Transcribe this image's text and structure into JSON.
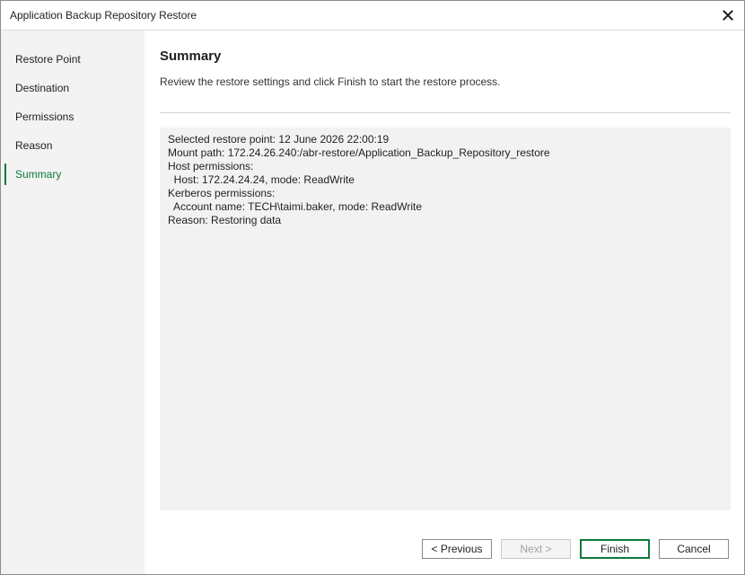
{
  "window": {
    "title": "Application Backup Repository Restore"
  },
  "sidebar": {
    "items": [
      {
        "label": "Restore Point"
      },
      {
        "label": "Destination"
      },
      {
        "label": "Permissions"
      },
      {
        "label": "Reason"
      },
      {
        "label": "Summary",
        "active": true
      }
    ]
  },
  "main": {
    "title": "Summary",
    "description": "Review the restore settings and click Finish to start the restore process.",
    "summary_lines": [
      "Selected restore point: 12 June 2026 22:00:19",
      "Mount path: 172.24.26.240:/abr-restore/Application_Backup_Repository_restore",
      "Host permissions:",
      "  Host: 172.24.24.24, mode: ReadWrite",
      "Kerberos permissions:",
      "  Account name: TECH\\taimi.baker, mode: ReadWrite",
      "Reason: Restoring data"
    ]
  },
  "buttons": {
    "previous": "< Previous",
    "next": "Next >",
    "finish": "Finish",
    "cancel": "Cancel"
  },
  "colors": {
    "accent": "#0f7a3a",
    "sidebar_bg": "#f2f3f2",
    "summary_bg": "#f1f2f1"
  },
  "icons": {
    "close": "close-icon"
  }
}
